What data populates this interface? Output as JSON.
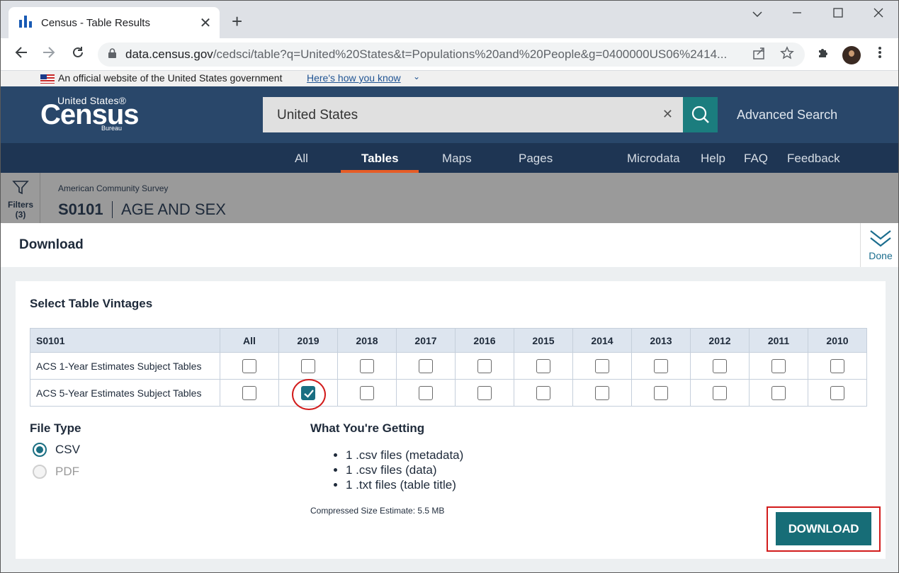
{
  "browser": {
    "tab_title": "Census - Table Results",
    "url_host": "data.census.gov",
    "url_rest": "/cedsci/table?q=United%20States&t=Populations%20and%20People&g=0400000US06%2414..."
  },
  "gov_banner": {
    "text": "An official website of the United States government",
    "link": "Here's how you know"
  },
  "header": {
    "logo_top": "United States®",
    "logo_main": "Census",
    "logo_bottom": "Bureau",
    "search_value": "United States",
    "advanced_search": "Advanced Search"
  },
  "nav": {
    "all": "All",
    "tables": "Tables",
    "maps": "Maps",
    "pages": "Pages",
    "microdata": "Microdata",
    "help": "Help",
    "faq": "FAQ",
    "feedback": "Feedback"
  },
  "subheader": {
    "filters_label": "Filters",
    "filters_count": "(3)",
    "survey": "American Community Survey",
    "table_id": "S0101",
    "table_name": "AGE AND SEX"
  },
  "download": {
    "title": "Download",
    "done_label": "Done",
    "vintages_title": "Select Table Vintages",
    "table_header": [
      "S0101",
      "All",
      "2019",
      "2018",
      "2017",
      "2016",
      "2015",
      "2014",
      "2013",
      "2012",
      "2011",
      "2010"
    ],
    "rows": [
      {
        "label": "ACS 1-Year Estimates Subject Tables",
        "checked": [
          false,
          false,
          false,
          false,
          false,
          false,
          false,
          false,
          false,
          false,
          false
        ]
      },
      {
        "label": "ACS 5-Year Estimates Subject Tables",
        "checked": [
          false,
          true,
          false,
          false,
          false,
          false,
          false,
          false,
          false,
          false,
          false
        ]
      }
    ],
    "file_type_title": "File Type",
    "csv_label": "CSV",
    "pdf_label": "PDF",
    "getting_title": "What You're Getting",
    "getting_items": [
      "1 .csv files (metadata)",
      "1 .csv files (data)",
      "1 .txt files (table title)"
    ],
    "size_estimate": "Compressed Size Estimate: 5.5 MB",
    "button_label": "DOWNLOAD"
  },
  "colors": {
    "header_bg": "#29476a",
    "nav_bg": "#1e3553",
    "accent_teal": "#176d77",
    "nav_underline": "#e65c26",
    "highlight_red": "#d21b1b"
  }
}
